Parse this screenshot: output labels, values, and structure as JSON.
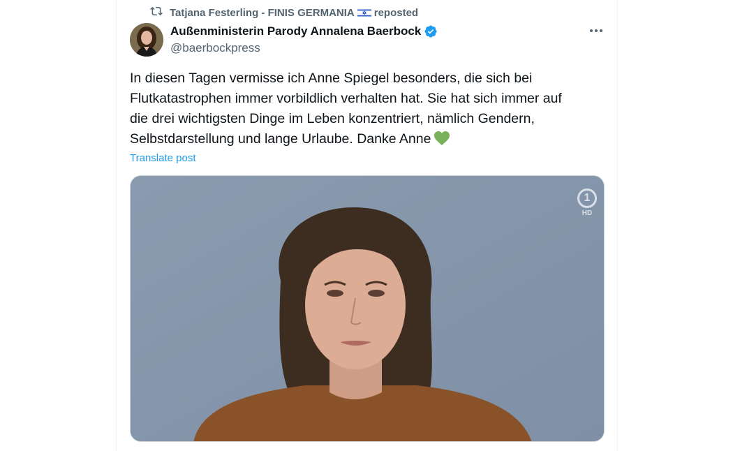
{
  "repost": {
    "user": "Tatjana Festerling - FINIS GERMANIA",
    "suffix": "reposted",
    "flag_icon": "israel-flag-icon",
    "icon": "repost-icon"
  },
  "author": {
    "name": "Außenministerin Parody Annalena Baerbock",
    "handle": "@baerbockpress",
    "verified": true,
    "badge_color": "#1d9bf0"
  },
  "post": {
    "lines": [
      "In diesen Tagen vermisse ich Anne Spiegel besonders, die sich bei",
      "Flutkatastrophen immer vorbildlich verhalten hat. Sie hat sich immer auf",
      "die drei wichtigsten Dinge im Leben konzentriert, nämlich Gendern,",
      "Selbstdarstellung und lange Urlaube. Danke Anne"
    ],
    "emoji": "green-heart-icon",
    "translate_label": "Translate post"
  },
  "media": {
    "channel_logo": "1",
    "hd_label": "HD"
  },
  "colors": {
    "link": "#1d9bf0",
    "secondary_text": "#536471",
    "primary_text": "#0f1419",
    "heart": "#78b159"
  }
}
